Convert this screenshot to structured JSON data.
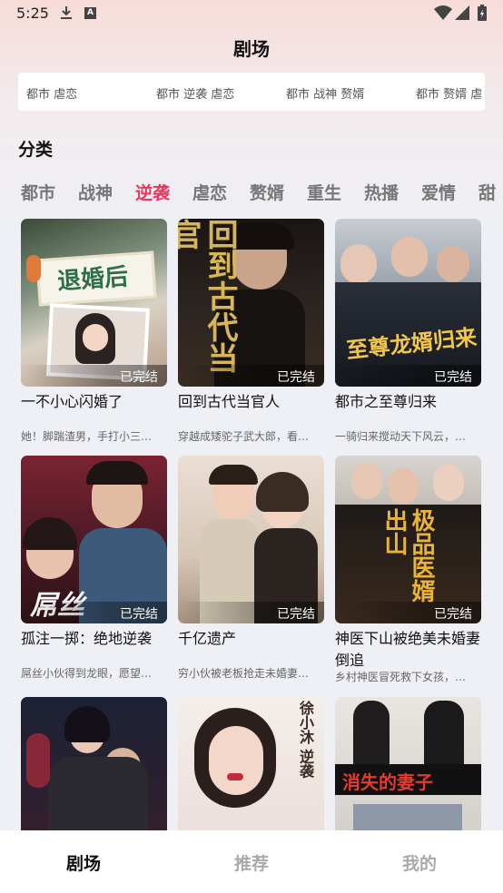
{
  "status_bar": {
    "time": "5:25"
  },
  "page_title": "剧场",
  "tag_strip": [
    "都市 虐恋",
    "都市 逆袭 虐恋",
    "都市 战神 赘婿",
    "都市 赘婿 虐"
  ],
  "section_title": "分类",
  "categories": [
    {
      "label": "都市",
      "active": false
    },
    {
      "label": "战神",
      "active": false
    },
    {
      "label": "逆袭",
      "active": true
    },
    {
      "label": "虐恋",
      "active": false
    },
    {
      "label": "赘婿",
      "active": false
    },
    {
      "label": "重生",
      "active": false
    },
    {
      "label": "热播",
      "active": false
    },
    {
      "label": "爱情",
      "active": false
    },
    {
      "label": "甜",
      "active": false
    }
  ],
  "dramas": [
    {
      "title": "一不小心闪婚了",
      "desc": "她！脚踹渣男，手打小三…",
      "badge": "已完结",
      "poster_text": "退婚后"
    },
    {
      "title": "回到古代当官人",
      "desc": "穿越成矮驼子武大郎，看…",
      "badge": "已完结",
      "poster_text": "回到古代当官"
    },
    {
      "title": "都市之至尊归来",
      "desc": "一骑归来搅动天下风云，…",
      "badge": "已完结",
      "poster_text": "至尊龙婿归来"
    },
    {
      "title": "孤注一掷：绝地逆袭",
      "desc": "屌丝小伙得到龙眼，愿望…",
      "badge": "已完结",
      "poster_text": "屌丝"
    },
    {
      "title": "千亿遗产",
      "desc": "穷小伙被老板抢走未婚妻…",
      "badge": "已完结",
      "poster_text": ""
    },
    {
      "title": "神医下山被绝美未婚妻倒追",
      "desc": "乡村神医冒死救下女孩，…",
      "badge": "已完结",
      "poster_text": "极品医婿出山"
    },
    {
      "title": "",
      "desc": "",
      "badge": "",
      "poster_text": ""
    },
    {
      "title": "",
      "desc": "",
      "badge": "",
      "poster_text": "徐小沐 逆袭"
    },
    {
      "title": "",
      "desc": "",
      "badge": "",
      "poster_text": "消失的妻子"
    }
  ],
  "bottom_nav": [
    {
      "label": "剧场",
      "active": true
    },
    {
      "label": "推荐",
      "active": false
    },
    {
      "label": "我的",
      "active": false
    }
  ],
  "colors": {
    "accent": "#e8365d",
    "muted": "#777777"
  }
}
